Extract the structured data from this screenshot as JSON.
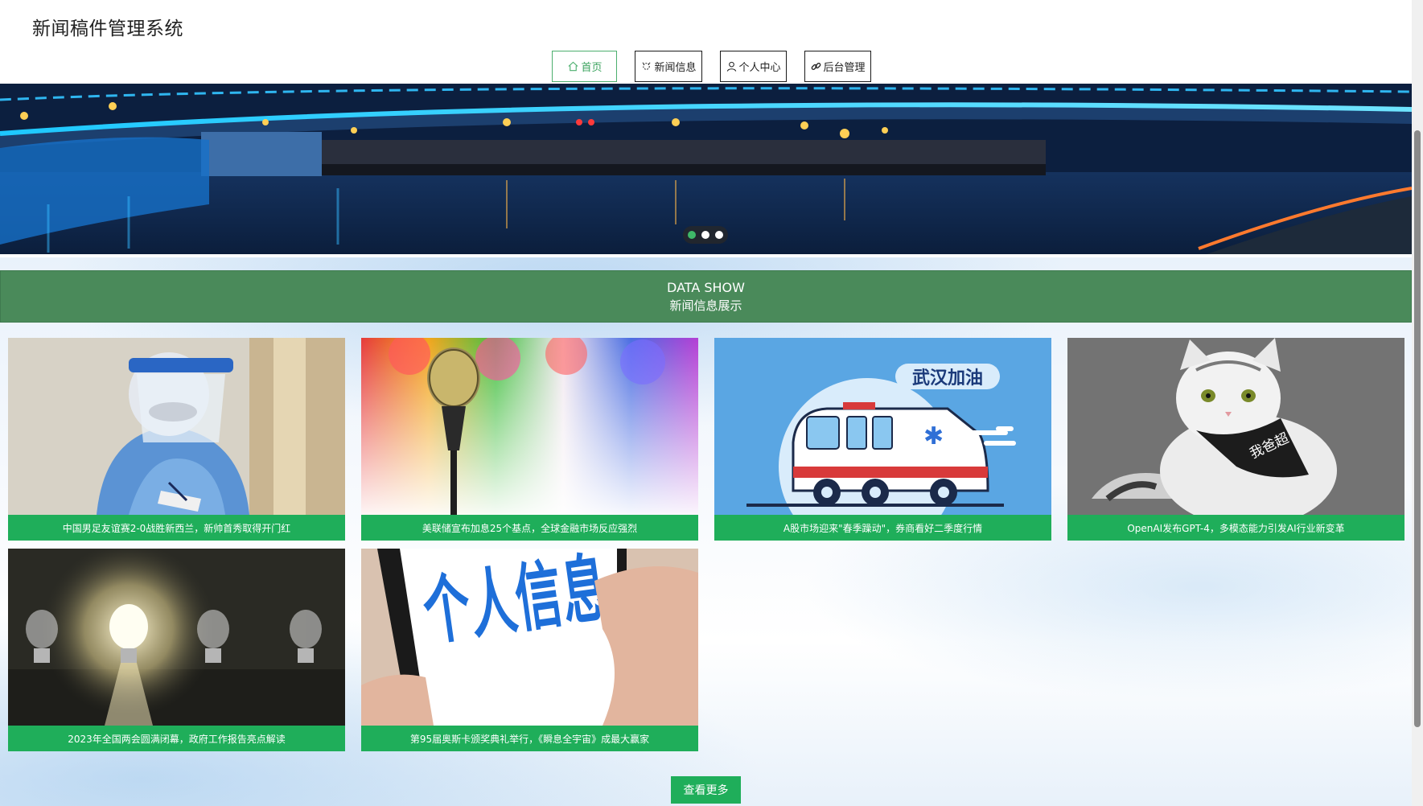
{
  "header": {
    "site_title": "新闻稿件管理系统"
  },
  "nav": [
    {
      "label": "首页",
      "icon": "home-icon",
      "active": true
    },
    {
      "label": "新闻信息",
      "icon": "news-icon",
      "active": false
    },
    {
      "label": "个人中心",
      "icon": "user-icon",
      "active": false
    },
    {
      "label": "后台管理",
      "icon": "link-icon",
      "active": false
    }
  ],
  "banner": {
    "slide_count": 3,
    "active_slide": 1
  },
  "section": {
    "title_en": "DATA SHOW",
    "title_cn": "新闻信息展示"
  },
  "news": [
    {
      "caption": "中国男足友谊赛2-0战胜新西兰，新帅首秀取得开门红",
      "image": "medical-worker-photo"
    },
    {
      "caption": "美联储宣布加息25个基点，全球金融市场反应强烈",
      "image": "microphone-stage-photo"
    },
    {
      "caption": "A股市场迎来\"春季躁动\"，券商看好二季度行情",
      "image": "ambulance-illustration",
      "image_text": "武汉加油"
    },
    {
      "caption": "OpenAI发布GPT-4，多模态能力引发AI行业新变革",
      "image": "cat-photo",
      "image_text": "我爸超"
    },
    {
      "caption": "2023年全国两会圆满闭幕，政府工作报告亮点解读",
      "image": "light-bulbs-photo"
    },
    {
      "caption": "第95届奥斯卡颁奖典礼举行，《瞬息全宇宙》成最大赢家",
      "image": "personal-info-phone-photo",
      "image_text": "个人信息"
    }
  ],
  "more_button": {
    "label": "查看更多"
  },
  "colors": {
    "accent": "#1fae5a",
    "section": "#4a8a5a"
  }
}
